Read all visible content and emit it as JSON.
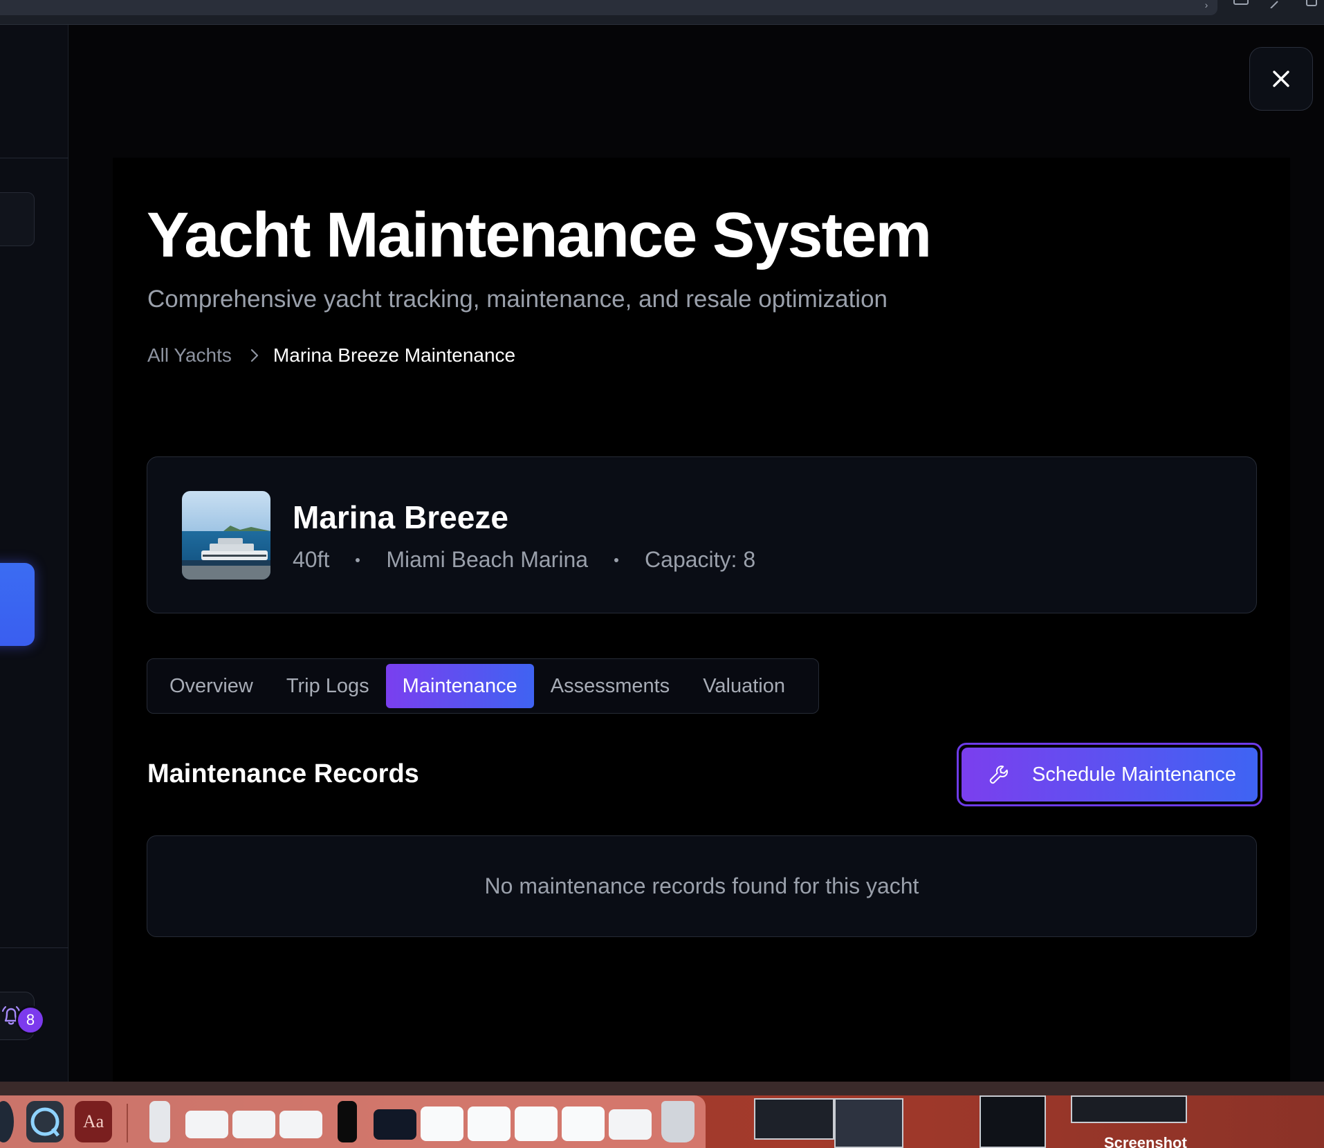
{
  "header": {
    "title": "Yacht Maintenance System",
    "subtitle": "Comprehensive yacht tracking, maintenance, and resale optimization"
  },
  "breadcrumb": {
    "root": "All Yachts",
    "current": "Marina Breeze Maintenance"
  },
  "yacht": {
    "name": "Marina Breeze",
    "length": "40ft",
    "location": "Miami Beach Marina",
    "capacity": "Capacity: 8"
  },
  "tabs": [
    {
      "label": "Overview",
      "active": false
    },
    {
      "label": "Trip Logs",
      "active": false
    },
    {
      "label": "Maintenance",
      "active": true
    },
    {
      "label": "Assessments",
      "active": false
    },
    {
      "label": "Valuation",
      "active": false
    }
  ],
  "maintenance": {
    "section_title": "Maintenance Records",
    "schedule_button": "Schedule Maintenance",
    "empty_message": "No maintenance records found for this yacht"
  },
  "sidebar": {
    "notification_count": "8"
  },
  "dock": {
    "dictionary_label": "Aa",
    "screenshot_label": "Screenshot"
  },
  "colors": {
    "accent_purple": "#7a3fef",
    "accent_blue": "#3f63f2",
    "card_bg": "#0a0d15",
    "muted_text": "#9aa0ab"
  }
}
